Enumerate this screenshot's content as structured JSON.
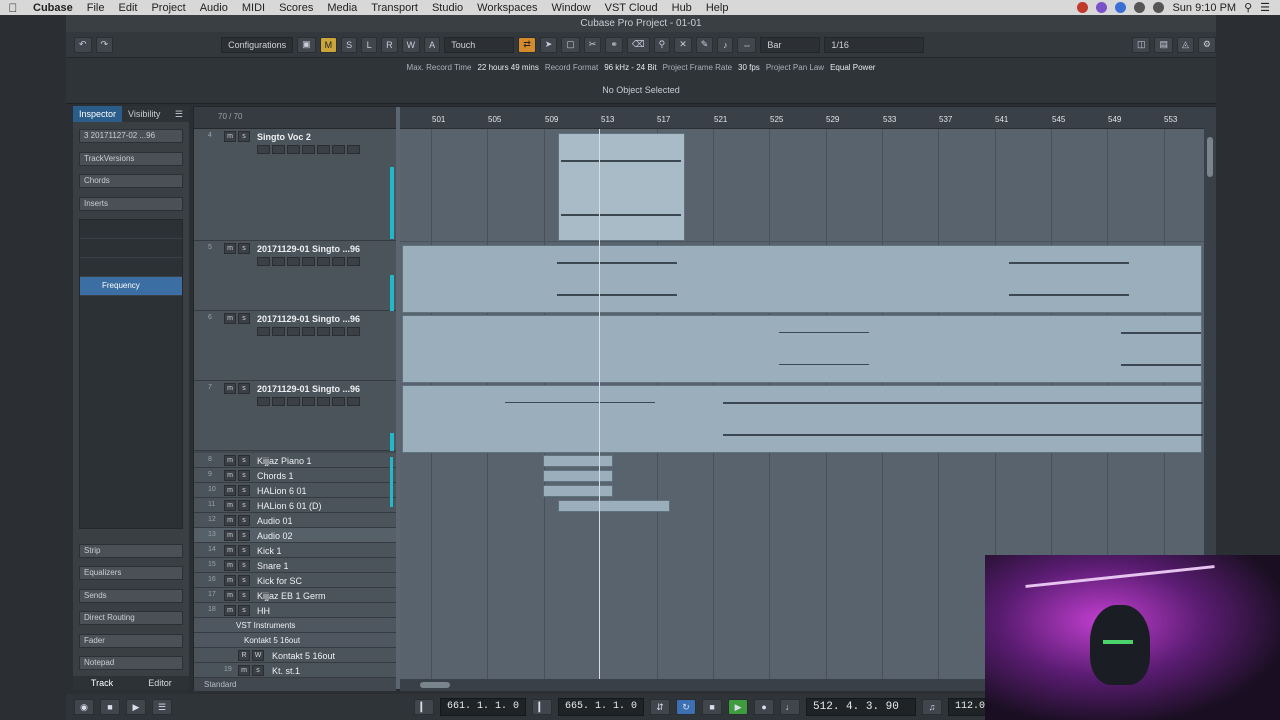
{
  "menubar": {
    "app": "Cubase",
    "items": [
      "File",
      "Edit",
      "Project",
      "Audio",
      "MIDI",
      "Scores",
      "Media",
      "Transport",
      "Studio",
      "Workspaces",
      "Window",
      "VST Cloud",
      "Hub",
      "Help"
    ],
    "clock": "Sun 9:10 PM"
  },
  "window": {
    "title": "Cubase Pro Project - 01-01"
  },
  "toolbar": {
    "configurations": "Configurations",
    "automation_mode": "Touch",
    "grid_type": "Bar",
    "quantize": "1/16",
    "m_label": "M",
    "s_label": "S",
    "l_label": "L",
    "r_label": "R",
    "w_label": "W",
    "a_label": "A"
  },
  "info_line": {
    "record_time_label": "Max. Record Time",
    "record_time": "22 hours 49 mins",
    "format_label": "Record Format",
    "format": "96 kHz - 24 Bit",
    "frame_label": "Project Frame Rate",
    "frame": "30 fps",
    "panlaw_label": "Project Pan Law",
    "panlaw": "Equal Power"
  },
  "status": "No Object Selected",
  "inspector": {
    "tabs": [
      "Inspector",
      "Visibility"
    ],
    "track_name": "3  20171127-02 ...96",
    "sections_top": [
      "TrackVersions",
      "Chords",
      "Inserts"
    ],
    "insert_slot": "Frequency",
    "sections_bottom": [
      "Strip",
      "Equalizers",
      "Sends",
      "Direct Routing",
      "Fader",
      "Notepad"
    ],
    "bottom_tabs": [
      "Track",
      "Editor"
    ]
  },
  "tracklist": {
    "header": "70 / 70",
    "footer": "Standard",
    "tracks": [
      {
        "num": "4",
        "name": "Singto Voc 2"
      },
      {
        "num": "5",
        "name": "20171129-01 Singto ...96"
      },
      {
        "num": "6",
        "name": "20171129-01 Singto ...96"
      },
      {
        "num": "7",
        "name": "20171129-01 Singto ...96"
      },
      {
        "num": "8",
        "name": "Kijjaz Piano 1"
      },
      {
        "num": "9",
        "name": "Chords 1"
      },
      {
        "num": "10",
        "name": "HALion 6 01"
      },
      {
        "num": "11",
        "name": "HALion 6 01 (D)"
      },
      {
        "num": "12",
        "name": "Audio 01"
      },
      {
        "num": "13",
        "name": "Audio 02"
      },
      {
        "num": "14",
        "name": "Kick 1"
      },
      {
        "num": "15",
        "name": "Snare 1"
      },
      {
        "num": "16",
        "name": "Kick for SC"
      },
      {
        "num": "17",
        "name": "Kijjaz EB 1 Germ"
      },
      {
        "num": "18",
        "name": "HH"
      }
    ],
    "folder_label": "VST Instruments",
    "subfolder_label": "Kontakt 5 16out",
    "inst_track": "Kontakt 5 16out",
    "last_track": "Kt. st.1",
    "last_num": "19"
  },
  "ruler": {
    "bars": [
      "501",
      "505",
      "509",
      "513",
      "517",
      "521",
      "525",
      "529",
      "533",
      "537",
      "541",
      "545",
      "549",
      "553"
    ]
  },
  "transport": {
    "left_locator": "661. 1. 1.   0",
    "right_locator": "665. 1. 1.   0",
    "position": "512. 4. 3.  90",
    "tempo": "112.000"
  }
}
